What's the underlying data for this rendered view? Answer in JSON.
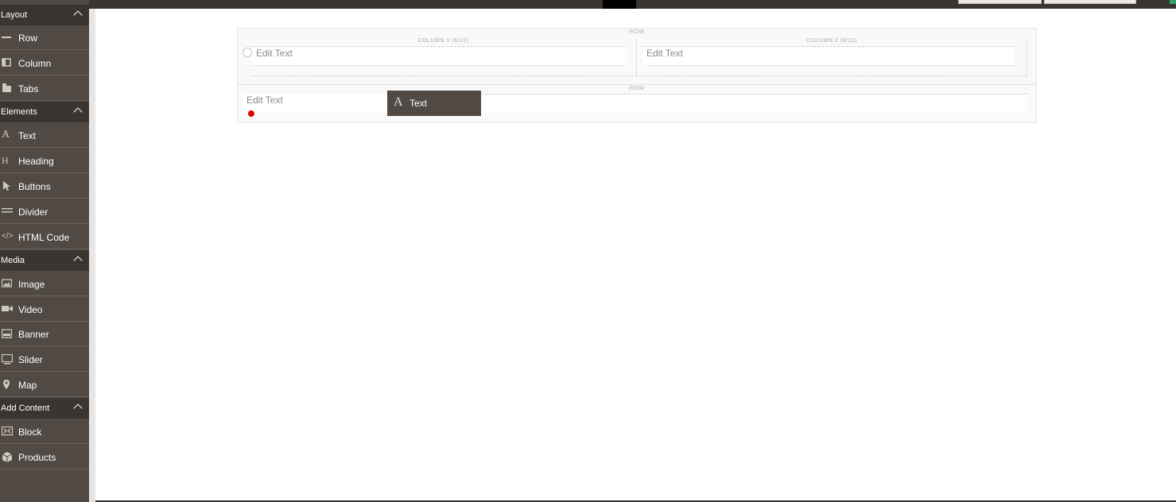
{
  "sidebar": {
    "sections": [
      {
        "title": "Layout",
        "items": [
          {
            "label": "Row",
            "icon": "row-icon"
          },
          {
            "label": "Column",
            "icon": "column-icon"
          },
          {
            "label": "Tabs",
            "icon": "tabs-icon"
          }
        ]
      },
      {
        "title": "Elements",
        "items": [
          {
            "label": "Text",
            "icon": "text-icon"
          },
          {
            "label": "Heading",
            "icon": "heading-icon"
          },
          {
            "label": "Buttons",
            "icon": "cursor-icon"
          },
          {
            "label": "Divider",
            "icon": "divider-icon"
          },
          {
            "label": "HTML Code",
            "icon": "code-icon"
          }
        ]
      },
      {
        "title": "Media",
        "items": [
          {
            "label": "Image",
            "icon": "image-icon"
          },
          {
            "label": "Video",
            "icon": "video-icon"
          },
          {
            "label": "Banner",
            "icon": "banner-icon"
          },
          {
            "label": "Slider",
            "icon": "slider-icon"
          },
          {
            "label": "Map",
            "icon": "map-pin-icon"
          }
        ]
      },
      {
        "title": "Add Content",
        "items": [
          {
            "label": "Block",
            "icon": "block-icon"
          },
          {
            "label": "Products",
            "icon": "products-icon"
          }
        ]
      }
    ]
  },
  "stage": {
    "row1": {
      "caption": "ROW",
      "col1": {
        "caption": "COLUMN 1 (6/12)",
        "text": "Edit Text"
      },
      "col2": {
        "caption": "COLUMN 2 (6/12)",
        "text": "Edit Text"
      }
    },
    "row2": {
      "caption": "ROW",
      "text": "Edit Text"
    }
  },
  "drag_helper": {
    "icon": "A",
    "label": "Text"
  },
  "colors": {
    "sidebar": "#514943",
    "sidebar_header": "#3b3531",
    "accent": "#33a56b",
    "drop_marker": "#e10000"
  }
}
